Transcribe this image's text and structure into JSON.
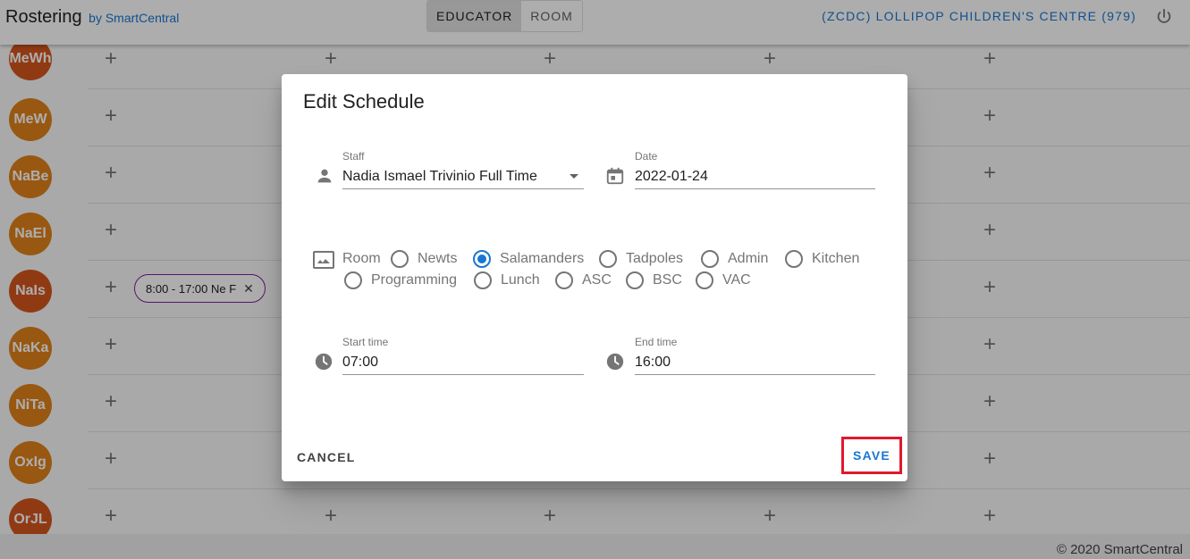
{
  "header": {
    "app_title": "Rostering",
    "app_by": "by SmartCentral",
    "toggle": [
      "EDUCATOR",
      "ROOM"
    ],
    "toggle_active": "EDUCATOR",
    "centre": "(ZCDC) LOLLIPOP CHILDREN'S CENTRE (979)"
  },
  "grid": {
    "rows": [
      {
        "initials": "MeWh",
        "color": "#d4561e"
      },
      {
        "initials": "MeW",
        "color": "#e0821a"
      },
      {
        "initials": "NaBe",
        "color": "#e0821a"
      },
      {
        "initials": "NaEl",
        "color": "#e0821a"
      },
      {
        "initials": "NaIs",
        "color": "#d4561e"
      },
      {
        "initials": "NaKa",
        "color": "#e0821a"
      },
      {
        "initials": "NiTa",
        "color": "#e0821a"
      },
      {
        "initials": "OxIg",
        "color": "#e0821a"
      },
      {
        "initials": "OrJL",
        "color": "#d4561e"
      }
    ],
    "chip": {
      "label": "8:00 - 17:00 Ne F",
      "close": "✕"
    }
  },
  "footer": {
    "text": "© 2020 SmartCentral"
  },
  "dialog": {
    "title": "Edit Schedule",
    "staff": {
      "label": "Staff",
      "value": "Nadia Ismael Trivinio Full Time"
    },
    "date": {
      "label": "Date",
      "value": "2022-01-24"
    },
    "room": {
      "label": "Room",
      "options": [
        "Newts",
        "Salamanders",
        "Tadpoles",
        "Admin",
        "Kitchen",
        "Programming",
        "Lunch",
        "ASC",
        "BSC",
        "VAC"
      ],
      "selected": "Salamanders"
    },
    "start_time": {
      "label": "Start time",
      "value": "07:00"
    },
    "end_time": {
      "label": "End time",
      "value": "16:00"
    },
    "cancel_label": "CANCEL",
    "save_label": "SAVE"
  },
  "colors": {
    "accent": "#1976d2",
    "highlight": "#e0182d",
    "chip_border": "#7b1fa2"
  }
}
